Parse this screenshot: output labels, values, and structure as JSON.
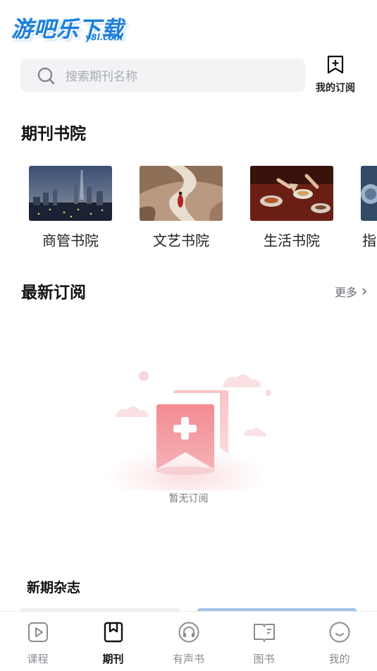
{
  "watermark": {
    "main": "游吧乐下载",
    "sub": "y8l.com"
  },
  "search": {
    "placeholder": "搜索期刊名称"
  },
  "header": {
    "subscribe_label": "我的订阅"
  },
  "sections": {
    "academies_title": "期刊书院",
    "latest_title": "最新订阅",
    "latest_more": "更多",
    "new_issues_title": "新期杂志"
  },
  "academies": [
    {
      "label": "商管书院",
      "image": "city-skyline"
    },
    {
      "label": "文艺书院",
      "image": "desert-path"
    },
    {
      "label": "生活书院",
      "image": "dinner-table"
    },
    {
      "label": "指",
      "image": "blue-partial"
    }
  ],
  "empty_state": {
    "text": "暂无订阅"
  },
  "tabs": [
    {
      "label": "课程",
      "icon": "play-square-icon",
      "active": false
    },
    {
      "label": "期刊",
      "icon": "bookmark-square-icon",
      "active": true
    },
    {
      "label": "有声书",
      "icon": "headphones-icon",
      "active": false
    },
    {
      "label": "图书",
      "icon": "book-icon",
      "active": false
    },
    {
      "label": "我的",
      "icon": "smile-icon",
      "active": false
    }
  ],
  "colors": {
    "accent": "#1e7fd8",
    "empty_pink": "#f07a83",
    "tab_inactive": "#8a8d93"
  }
}
